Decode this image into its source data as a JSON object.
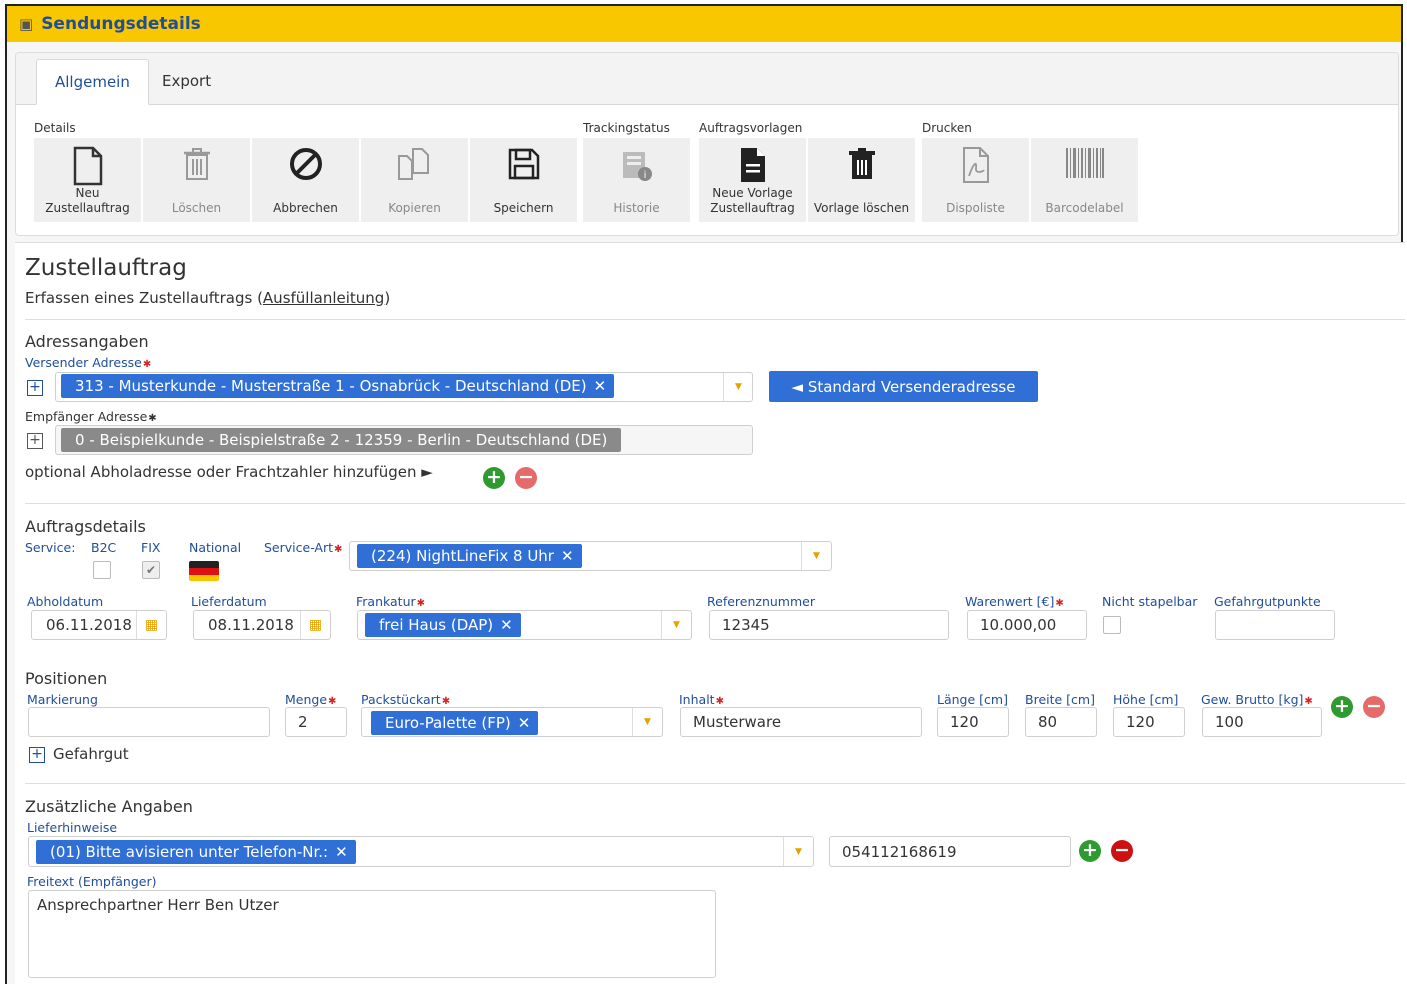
{
  "window": {
    "title": "Sendungsdetails",
    "icon": "box-icon"
  },
  "tabs": [
    {
      "label": "Allgemein",
      "active": true
    },
    {
      "label": "Export",
      "active": false
    }
  ],
  "ribbon": {
    "groups": {
      "details": "Details",
      "tracking": "Trackingstatus",
      "vorlagen": "Auftragsvorlagen",
      "drucken": "Drucken"
    },
    "buttons": {
      "neu": "Neu\nZustellauftrag",
      "loeschen": "Löschen",
      "abbrechen": "Abbrechen",
      "kopieren": "Kopieren",
      "speichern": "Speichern",
      "historie": "Historie",
      "neue_vorlage": "Neue Vorlage\nZustellauftrag",
      "vorlage_loeschen": "Vorlage löschen",
      "dispoliste": "Dispoliste",
      "barcodelabel": "Barcodelabel"
    }
  },
  "form": {
    "title": "Zustellauftrag",
    "subtitle_prefix": "Erfassen eines Zustellauftrags (",
    "subtitle_link": "Ausfüllanleitung",
    "subtitle_suffix": ")",
    "address": {
      "heading": "Adressangaben",
      "sender_label": "Versender Adresse",
      "sender_value": "313 - Musterkunde - Musterstraße 1 - Osnabrück - Deutschland (DE)",
      "standard_button": "◄ Standard Versenderadresse",
      "recipient_label": "Empfänger Adresse",
      "recipient_value": "0 - Beispielkunde - Beispielstraße 2 - 12359 - Berlin - Deutschland (DE)",
      "optional_text": "optional Abholadresse oder Frachtzahler hinzufügen ►"
    },
    "order": {
      "heading": "Auftragsdetails",
      "service_label": "Service:",
      "b2c_label": "B2C",
      "fix_label": "FIX",
      "national_label": "National",
      "service_art_label": "Service-Art",
      "service_art_value": "(224) NightLineFix 8 Uhr",
      "abholdatum_label": "Abholdatum",
      "abholdatum_value": "06.11.2018",
      "lieferdatum_label": "Lieferdatum",
      "lieferdatum_value": "08.11.2018",
      "frankatur_label": "Frankatur",
      "frankatur_value": "frei Haus (DAP)",
      "referenz_label": "Referenznummer",
      "referenz_value": "12345",
      "warenwert_label": "Warenwert [€]",
      "warenwert_value": "10.000,00",
      "nicht_stapelbar_label": "Nicht stapelbar",
      "gefahrgut_label": "Gefahrgutpunkte",
      "gefahrgut_value": ""
    },
    "positions": {
      "heading": "Positionen",
      "markierung_label": "Markierung",
      "markierung_value": "",
      "menge_label": "Menge",
      "menge_value": "2",
      "packstueck_label": "Packstückart",
      "packstueck_value": "Euro-Palette (FP)",
      "inhalt_label": "Inhalt",
      "inhalt_value": "Musterware",
      "laenge_label": "Länge [cm]",
      "laenge_value": "120",
      "breite_label": "Breite [cm]",
      "breite_value": "80",
      "hoehe_label": "Höhe [cm]",
      "hoehe_value": "120",
      "gewicht_label": "Gew. Brutto [kg]",
      "gewicht_value": "100",
      "gefahrgut_toggle": "Gefahrgut"
    },
    "extra": {
      "heading": "Zusätzliche Angaben",
      "lieferhinweise_label": "Lieferhinweise",
      "lieferhinweise_value": "(01) Bitte avisieren unter Telefon-Nr.:",
      "telefon_value": "054112168619",
      "freitext_label": "Freitext (Empfänger)",
      "freitext_value": "Ansprechpartner Herr Ben Utzer"
    }
  },
  "colors": {
    "title_bar": "#f8c700",
    "accent_blue": "#2f6fd6",
    "label_blue": "#1f4e9b",
    "add_green": "#2f9a2f",
    "remove_red": "#cc1111"
  }
}
